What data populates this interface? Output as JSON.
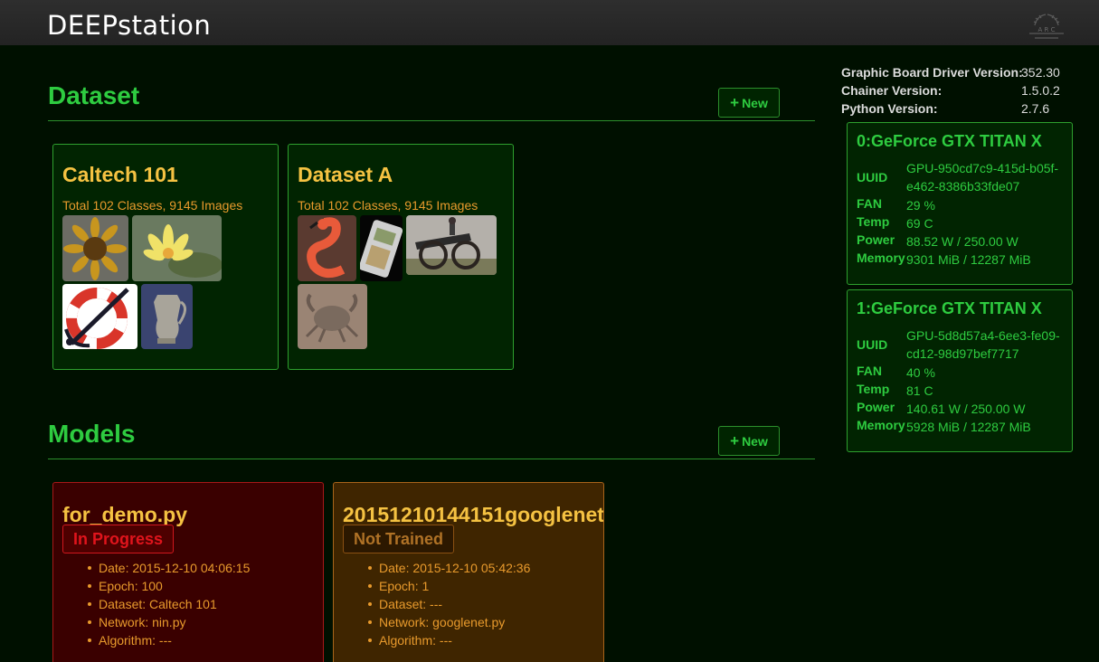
{
  "header": {
    "brand": "DEEPstation",
    "logo_text": "A R C"
  },
  "dataset": {
    "title": "Dataset",
    "new_label": "New",
    "cards": [
      {
        "title": "Caltech 101",
        "info": "Total 102 Classes, 9145 Images"
      },
      {
        "title": "Dataset A",
        "info": "Total 102 Classes, 9145 Images"
      }
    ]
  },
  "models": {
    "title": "Models",
    "new_label": "New",
    "cards": [
      {
        "title": "for_demo.py",
        "status": "In Progress",
        "details": [
          "Date: 2015-12-10 04:06:15",
          "Epoch: 100",
          "Dataset: Caltech 101",
          "Network: nin.py",
          "Algorithm: ---"
        ]
      },
      {
        "title": "20151210144151googlenet",
        "status": "Not Trained",
        "details": [
          "Date: 2015-12-10 05:42:36",
          "Epoch: 1",
          "Dataset: ---",
          "Network: googlenet.py",
          "Algorithm: ---"
        ]
      }
    ]
  },
  "versions": [
    {
      "label": "Graphic Board Driver Version:",
      "value": "352.30"
    },
    {
      "label": "Chainer Version:",
      "value": "1.5.0.2"
    },
    {
      "label": "Python Version:",
      "value": "2.7.6"
    }
  ],
  "gpus": [
    {
      "title": "0:GeForce GTX TITAN X",
      "uuid_label": "UUID",
      "uuid": "GPU-950cd7c9-415d-b05f-e462-8386b33fde07",
      "fan_label": "FAN",
      "fan": "29 %",
      "temp_label": "Temp",
      "temp": "69 C",
      "power_label": "Power",
      "power": "88.52 W / 250.00 W",
      "memory_label": "Memory",
      "memory": "9301 MiB / 12287 MiB"
    },
    {
      "title": "1:GeForce GTX TITAN X",
      "uuid_label": "UUID",
      "uuid": "GPU-5d8d57a4-6ee3-fe09-cd12-98d97bef7717",
      "fan_label": "FAN",
      "fan": "40 %",
      "temp_label": "Temp",
      "temp": "81 C",
      "power_label": "Power",
      "power": "140.61 W / 250.00 W",
      "memory_label": "Memory",
      "memory": "5928 MiB / 12287 MiB"
    }
  ],
  "colors": {
    "accent_green": "#2ecc40",
    "title_yellow": "#f5c242",
    "info_orange": "#e89a2c",
    "status_red": "#e0141c",
    "background": "#001000"
  }
}
